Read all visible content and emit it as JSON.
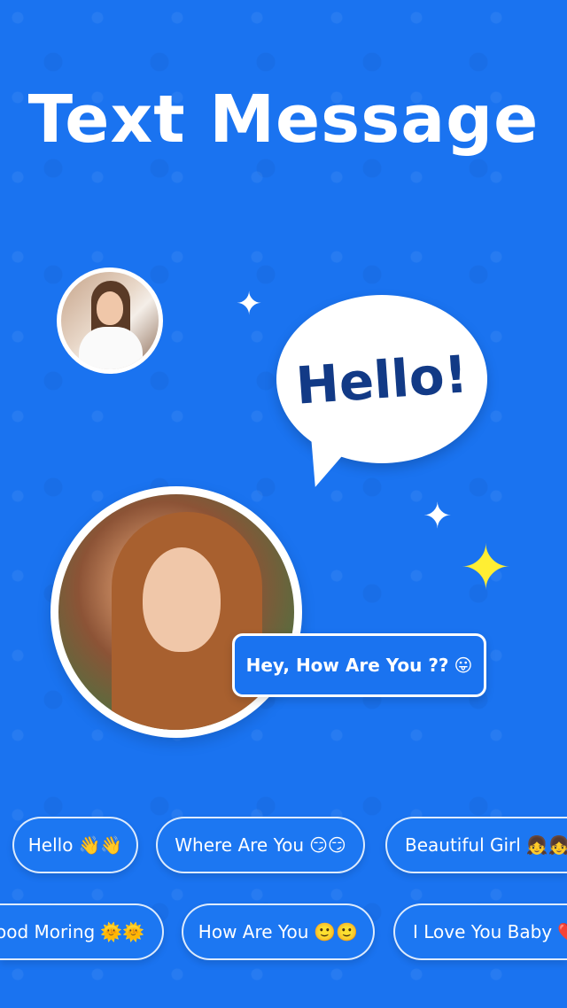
{
  "title": "Text Message",
  "speech_bubble": {
    "text": "Hello!"
  },
  "message_bubble": {
    "text": "Hey, How Are You ??",
    "emoji": "😛"
  },
  "sparkles": {
    "white": "✦",
    "yellow": "✦"
  },
  "quick_replies": [
    {
      "text": "Hello",
      "emoji": "👋👋"
    },
    {
      "text": "Where Are You",
      "emoji": "😏😏"
    },
    {
      "text": "Beautiful Girl",
      "emoji": "👧👧"
    },
    {
      "text": "ood Moring",
      "emoji": "🌞🌞"
    },
    {
      "text": "How Are You",
      "emoji": "🙂🙂"
    },
    {
      "text": "I Love You Baby",
      "emoji": "❤️"
    }
  ],
  "colors": {
    "background": "#1a73f0",
    "speech_text": "#123a86",
    "sparkle_yellow": "#ffee33"
  }
}
